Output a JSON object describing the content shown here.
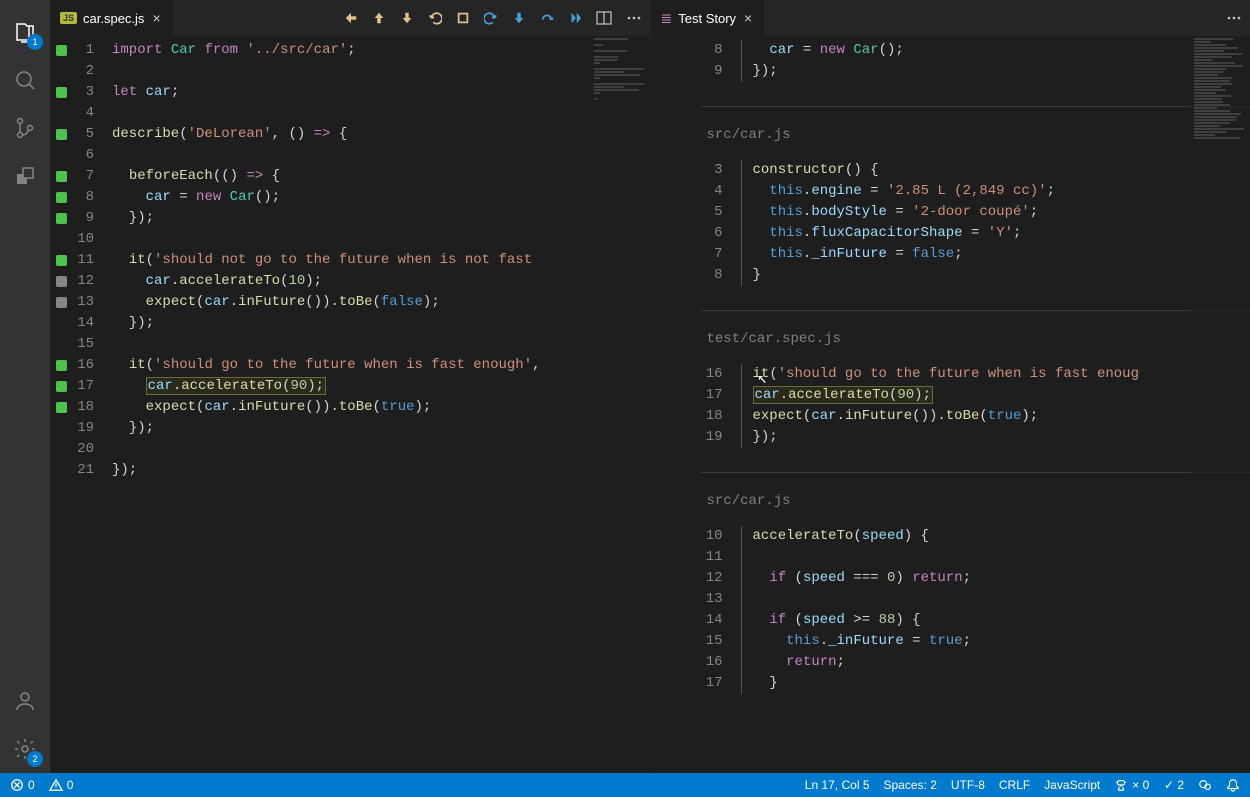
{
  "activity": {
    "explorerBadge": "1",
    "settingsBadge": "2"
  },
  "leftEditor": {
    "tabLabel": "car.spec.js",
    "jsBadge": "JS",
    "lines": [
      {
        "n": 1,
        "marker": "green",
        "tokens": [
          [
            "keyword",
            "import"
          ],
          [
            "punct",
            " "
          ],
          [
            "type",
            "Car"
          ],
          [
            "punct",
            " "
          ],
          [
            "keyword",
            "from"
          ],
          [
            "punct",
            " "
          ],
          [
            "string",
            "'../src/car'"
          ],
          [
            "punct",
            ";"
          ]
        ]
      },
      {
        "n": 2,
        "marker": "",
        "tokens": []
      },
      {
        "n": 3,
        "marker": "green",
        "tokens": [
          [
            "keyword",
            "let"
          ],
          [
            "punct",
            " "
          ],
          [
            "var",
            "car"
          ],
          [
            "punct",
            ";"
          ]
        ]
      },
      {
        "n": 4,
        "marker": "",
        "tokens": []
      },
      {
        "n": 5,
        "marker": "green",
        "tokens": [
          [
            "func",
            "describe"
          ],
          [
            "punct",
            "("
          ],
          [
            "string",
            "'DeLorean'"
          ],
          [
            "punct",
            ", () "
          ],
          [
            "keyword",
            "=>"
          ],
          [
            "punct",
            " {"
          ]
        ]
      },
      {
        "n": 6,
        "marker": "",
        "tokens": []
      },
      {
        "n": 7,
        "marker": "green",
        "tokens": [
          [
            "punct",
            "  "
          ],
          [
            "func",
            "beforeEach"
          ],
          [
            "punct",
            "(() "
          ],
          [
            "keyword",
            "=>"
          ],
          [
            "punct",
            " {"
          ]
        ]
      },
      {
        "n": 8,
        "marker": "green",
        "tokens": [
          [
            "punct",
            "    "
          ],
          [
            "var",
            "car"
          ],
          [
            "punct",
            " = "
          ],
          [
            "keyword",
            "new"
          ],
          [
            "punct",
            " "
          ],
          [
            "type",
            "Car"
          ],
          [
            "punct",
            "();"
          ]
        ]
      },
      {
        "n": 9,
        "marker": "green",
        "tokens": [
          [
            "punct",
            "  });"
          ]
        ]
      },
      {
        "n": 10,
        "marker": "",
        "tokens": []
      },
      {
        "n": 11,
        "marker": "green",
        "tokens": [
          [
            "punct",
            "  "
          ],
          [
            "func",
            "it"
          ],
          [
            "punct",
            "("
          ],
          [
            "string",
            "'should not go to the future when is not fast "
          ]
        ]
      },
      {
        "n": 12,
        "marker": "gray",
        "tokens": [
          [
            "punct",
            "    "
          ],
          [
            "var",
            "car"
          ],
          [
            "punct",
            "."
          ],
          [
            "func",
            "accelerateTo"
          ],
          [
            "punct",
            "("
          ],
          [
            "num",
            "10"
          ],
          [
            "punct",
            ");"
          ]
        ]
      },
      {
        "n": 13,
        "marker": "gray",
        "tokens": [
          [
            "punct",
            "    "
          ],
          [
            "func",
            "expect"
          ],
          [
            "punct",
            "("
          ],
          [
            "var",
            "car"
          ],
          [
            "punct",
            "."
          ],
          [
            "func",
            "inFuture"
          ],
          [
            "punct",
            "())."
          ],
          [
            "func",
            "toBe"
          ],
          [
            "punct",
            "("
          ],
          [
            "const",
            "false"
          ],
          [
            "punct",
            ");"
          ]
        ]
      },
      {
        "n": 14,
        "marker": "",
        "tokens": [
          [
            "punct",
            "  });"
          ]
        ]
      },
      {
        "n": 15,
        "marker": "",
        "tokens": []
      },
      {
        "n": 16,
        "marker": "green",
        "tokens": [
          [
            "punct",
            "  "
          ],
          [
            "func",
            "it"
          ],
          [
            "punct",
            "("
          ],
          [
            "string",
            "'should go to the future when is fast enough'"
          ],
          [
            "punct",
            ","
          ]
        ]
      },
      {
        "n": 17,
        "marker": "green",
        "hl": true,
        "tokens": [
          [
            "punct",
            "    "
          ],
          [
            "var",
            "car"
          ],
          [
            "punct",
            "."
          ],
          [
            "func",
            "accelerateTo"
          ],
          [
            "punct",
            "("
          ],
          [
            "num",
            "90"
          ],
          [
            "punct",
            ");"
          ]
        ]
      },
      {
        "n": 18,
        "marker": "green",
        "tokens": [
          [
            "punct",
            "    "
          ],
          [
            "func",
            "expect"
          ],
          [
            "punct",
            "("
          ],
          [
            "var",
            "car"
          ],
          [
            "punct",
            "."
          ],
          [
            "func",
            "inFuture"
          ],
          [
            "punct",
            "())."
          ],
          [
            "func",
            "toBe"
          ],
          [
            "punct",
            "("
          ],
          [
            "const",
            "true"
          ],
          [
            "punct",
            ");"
          ]
        ]
      },
      {
        "n": 19,
        "marker": "",
        "tokens": [
          [
            "punct",
            "  });"
          ]
        ]
      },
      {
        "n": 20,
        "marker": "",
        "tokens": []
      },
      {
        "n": 21,
        "marker": "",
        "tokens": [
          [
            "punct",
            "});"
          ]
        ]
      }
    ]
  },
  "rightEditor": {
    "tabLabel": "Test Story",
    "sections": [
      {
        "file": "",
        "rows": [
          {
            "n": 8,
            "dim": true,
            "tokens": [
              [
                "punct",
                "  "
              ],
              [
                "var",
                "car"
              ],
              [
                "punct",
                " = "
              ],
              [
                "keyword",
                "new"
              ],
              [
                "punct",
                " "
              ],
              [
                "type",
                "Car"
              ],
              [
                "punct",
                "();"
              ]
            ]
          },
          {
            "n": 9,
            "dim": true,
            "tokens": [
              [
                "punct",
                "});"
              ]
            ]
          }
        ]
      },
      {
        "file": "src/car.js",
        "rows": [
          {
            "n": 3,
            "tokens": [
              [
                "func",
                "constructor"
              ],
              [
                "punct",
                "() {"
              ]
            ]
          },
          {
            "n": 4,
            "tokens": [
              [
                "punct",
                "  "
              ],
              [
                "this",
                "this"
              ],
              [
                "punct",
                "."
              ],
              [
                "var",
                "engine"
              ],
              [
                "punct",
                " = "
              ],
              [
                "string",
                "'2.85 L (2,849 cc)'"
              ],
              [
                "punct",
                ";"
              ]
            ]
          },
          {
            "n": 5,
            "tokens": [
              [
                "punct",
                "  "
              ],
              [
                "this",
                "this"
              ],
              [
                "punct",
                "."
              ],
              [
                "var",
                "bodyStyle"
              ],
              [
                "punct",
                " = "
              ],
              [
                "string",
                "'2-door coupé'"
              ],
              [
                "punct",
                ";"
              ]
            ]
          },
          {
            "n": 6,
            "tokens": [
              [
                "punct",
                "  "
              ],
              [
                "this",
                "this"
              ],
              [
                "punct",
                "."
              ],
              [
                "var",
                "fluxCapacitorShape"
              ],
              [
                "punct",
                " = "
              ],
              [
                "string",
                "'Y'"
              ],
              [
                "punct",
                ";"
              ]
            ]
          },
          {
            "n": 7,
            "tokens": [
              [
                "punct",
                "  "
              ],
              [
                "this",
                "this"
              ],
              [
                "punct",
                "."
              ],
              [
                "var",
                "_inFuture"
              ],
              [
                "punct",
                " = "
              ],
              [
                "const",
                "false"
              ],
              [
                "punct",
                ";"
              ]
            ]
          },
          {
            "n": 8,
            "tokens": [
              [
                "punct",
                "}"
              ]
            ]
          }
        ]
      },
      {
        "file": "test/car.spec.js",
        "rows": [
          {
            "n": 16,
            "dim": true,
            "tokens": [
              [
                "func",
                "it"
              ],
              [
                "punct",
                "("
              ],
              [
                "string",
                "'should go to the future when is fast enoug"
              ]
            ]
          },
          {
            "n": 17,
            "hl": true,
            "tokens": [
              [
                "var",
                "car"
              ],
              [
                "punct",
                "."
              ],
              [
                "func",
                "accelerateTo"
              ],
              [
                "punct",
                "("
              ],
              [
                "num",
                "90"
              ],
              [
                "punct",
                ");"
              ]
            ]
          },
          {
            "n": 18,
            "dim": true,
            "tokens": [
              [
                "func",
                "expect"
              ],
              [
                "punct",
                "("
              ],
              [
                "var",
                "car"
              ],
              [
                "punct",
                "."
              ],
              [
                "func",
                "inFuture"
              ],
              [
                "punct",
                "())."
              ],
              [
                "func",
                "toBe"
              ],
              [
                "punct",
                "("
              ],
              [
                "const",
                "true"
              ],
              [
                "punct",
                ");"
              ]
            ]
          },
          {
            "n": 19,
            "dim": true,
            "tokens": [
              [
                "punct",
                "});"
              ]
            ]
          }
        ]
      },
      {
        "file": "src/car.js",
        "rows": [
          {
            "n": 10,
            "tokens": [
              [
                "func",
                "accelerateTo"
              ],
              [
                "punct",
                "("
              ],
              [
                "var",
                "speed"
              ],
              [
                "punct",
                ") {"
              ]
            ]
          },
          {
            "n": 11,
            "tokens": []
          },
          {
            "n": 12,
            "tokens": [
              [
                "punct",
                "  "
              ],
              [
                "keyword",
                "if"
              ],
              [
                "punct",
                " ("
              ],
              [
                "var",
                "speed"
              ],
              [
                "punct",
                " === "
              ],
              [
                "num",
                "0"
              ],
              [
                "punct",
                ") "
              ],
              [
                "keyword",
                "return"
              ],
              [
                "punct",
                ";"
              ]
            ]
          },
          {
            "n": 13,
            "tokens": []
          },
          {
            "n": 14,
            "tokens": [
              [
                "punct",
                "  "
              ],
              [
                "keyword",
                "if"
              ],
              [
                "punct",
                " ("
              ],
              [
                "var",
                "speed"
              ],
              [
                "punct",
                " >= "
              ],
              [
                "num",
                "88"
              ],
              [
                "punct",
                ") {"
              ]
            ]
          },
          {
            "n": 15,
            "tokens": [
              [
                "punct",
                "    "
              ],
              [
                "this",
                "this"
              ],
              [
                "punct",
                "."
              ],
              [
                "var",
                "_inFuture"
              ],
              [
                "punct",
                " = "
              ],
              [
                "const",
                "true"
              ],
              [
                "punct",
                ";"
              ]
            ]
          },
          {
            "n": 16,
            "tokens": [
              [
                "punct",
                "    "
              ],
              [
                "keyword",
                "return"
              ],
              [
                "punct",
                ";"
              ]
            ]
          },
          {
            "n": 17,
            "tokens": [
              [
                "punct",
                "  }"
              ]
            ]
          }
        ]
      }
    ]
  },
  "statusBar": {
    "errors": "0",
    "warnings": "0",
    "position": "Ln 17, Col 5",
    "spaces": "Spaces: 2",
    "encoding": "UTF-8",
    "eol": "CRLF",
    "language": "JavaScript",
    "testFail": "× 0",
    "testPass": "✓ 2"
  }
}
